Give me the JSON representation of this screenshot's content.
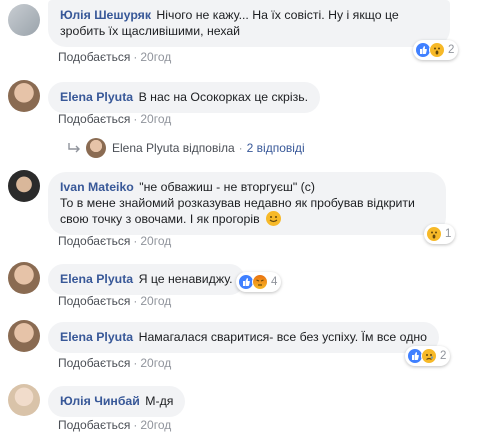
{
  "labels": {
    "like": "Подобається",
    "reply": "Відповісти",
    "dot": "·"
  },
  "comments": [
    {
      "author": "Юлія Шешуряк",
      "text_lines": [
        "Нічого не кажу... На їх совісті. Ну і якщо це",
        "зробить їх щасливішими, нехай"
      ],
      "time": "20год",
      "reactions": {
        "count": "2",
        "types": [
          "like-icon",
          "wow-icon"
        ]
      }
    },
    {
      "author": "Elena Plyuta",
      "text_lines": [
        "В нас на Осокорках це скрізь."
      ],
      "time": "20год"
    },
    {
      "reply_summary": {
        "author": "Elena Plyuta",
        "verb": "відповіла",
        "count_text": "2 відповіді"
      }
    },
    {
      "author": "Ivan Mateiko",
      "text_lines": [
        "\"не обважиш - не вторгуєш\" (с)",
        "То в мене знайомий розказував недавно як пробував відкрити",
        "свою точку з овочами. І як прогорів"
      ],
      "time": "20год",
      "reactions": {
        "count": "1",
        "types": [
          "wow-icon"
        ]
      }
    },
    {
      "author": "Elena Plyuta",
      "text_lines": [
        "Я це ненавиджу."
      ],
      "time": "20год",
      "reactions": {
        "count": "4",
        "types": [
          "like-icon",
          "angry-icon"
        ]
      }
    },
    {
      "author": "Elena Plyuta",
      "text_lines": [
        "Намагалася сваритися- все без успіху. Їм все одно"
      ],
      "time": "20год",
      "reactions": {
        "count": "2",
        "types": [
          "like-icon",
          "sad-icon"
        ]
      }
    },
    {
      "author": "Юлія Чинбай",
      "text_lines": [
        "М-дя"
      ],
      "time": "20год"
    }
  ],
  "colors": {
    "link": "#385898",
    "bubble": "#f2f3f5",
    "like": "#4080ff",
    "wow": "#f7b928",
    "angry": "#e9710f"
  }
}
